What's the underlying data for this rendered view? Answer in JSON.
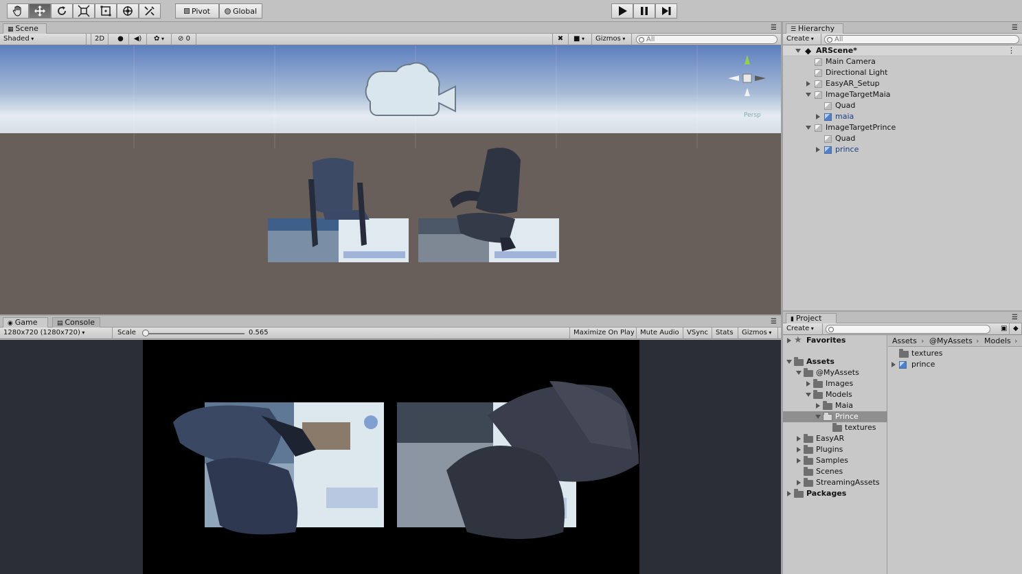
{
  "toolbar": {
    "tools": [
      "hand-tool",
      "move-tool",
      "rotate-tool",
      "scale-tool",
      "rect-tool",
      "transform-tool",
      "custom-tool"
    ],
    "pivot_label": "Pivot",
    "global_label": "Global",
    "play_controls": [
      "play",
      "pause",
      "step"
    ]
  },
  "scene": {
    "tab": "Scene",
    "shading": "Shaded",
    "mode_2d": "2D",
    "hidden_count": "0",
    "gizmos": "Gizmos",
    "search_placeholder": "All",
    "persp_label": "Persp"
  },
  "game": {
    "tab": "Game",
    "console_tab": "Console",
    "resolution": "1280x720 (1280x720)",
    "scale_label": "Scale",
    "scale_value": "0.565",
    "scale_fraction": 0.02,
    "maximize": "Maximize On Play",
    "mute": "Mute Audio",
    "vsync": "VSync",
    "stats": "Stats",
    "gizmos": "Gizmos"
  },
  "hierarchy": {
    "tab": "Hierarchy",
    "create": "Create",
    "search_placeholder": "All",
    "scene_name": "ARScene*",
    "items": [
      {
        "label": "Main Camera",
        "expander": "none",
        "icon": "cube-icon"
      },
      {
        "label": "Directional Light",
        "expander": "none",
        "icon": "cube-icon"
      },
      {
        "label": "EasyAR_Setup",
        "expander": "collapsed",
        "icon": "cube-icon"
      },
      {
        "label": "ImageTargetMaia",
        "expander": "expanded",
        "icon": "cube-icon"
      },
      {
        "label": "Quad",
        "expander": "none",
        "icon": "cube-icon"
      },
      {
        "label": "maia",
        "expander": "collapsed",
        "icon": "prefab-icon"
      },
      {
        "label": "ImageTargetPrince",
        "expander": "expanded",
        "icon": "cube-icon"
      },
      {
        "label": "Quad",
        "expander": "none",
        "icon": "cube-icon"
      },
      {
        "label": "prince",
        "expander": "collapsed",
        "icon": "prefab-icon"
      }
    ]
  },
  "project": {
    "tab": "Project",
    "create": "Create",
    "favorites": "Favorites",
    "tree": [
      {
        "label": "Assets",
        "expander": "expanded",
        "bold": true
      },
      {
        "label": "@MyAssets",
        "expander": "expanded"
      },
      {
        "label": "Images",
        "expander": "collapsed"
      },
      {
        "label": "Models",
        "expander": "expanded"
      },
      {
        "label": "Maia",
        "expander": "collapsed"
      },
      {
        "label": "Prince",
        "expander": "expanded",
        "selected": true
      },
      {
        "label": "textures",
        "expander": "none"
      },
      {
        "label": "EasyAR",
        "expander": "collapsed"
      },
      {
        "label": "Plugins",
        "expander": "collapsed"
      },
      {
        "label": "Samples",
        "expander": "collapsed"
      },
      {
        "label": "Scenes",
        "expander": "none"
      },
      {
        "label": "StreamingAssets",
        "expander": "collapsed"
      },
      {
        "label": "Packages",
        "expander": "collapsed",
        "bold": true
      }
    ],
    "breadcrumb": [
      "Assets",
      "@MyAssets",
      "Models"
    ],
    "files": [
      {
        "label": "textures",
        "icon": "folder-icon"
      },
      {
        "label": "prince",
        "icon": "prefab-icon"
      }
    ]
  },
  "colors": {
    "selection": "#8f8f8f",
    "sky_top": "#5d7fbf",
    "ground": "#685f5a",
    "game_bg": "#2b2e36"
  }
}
